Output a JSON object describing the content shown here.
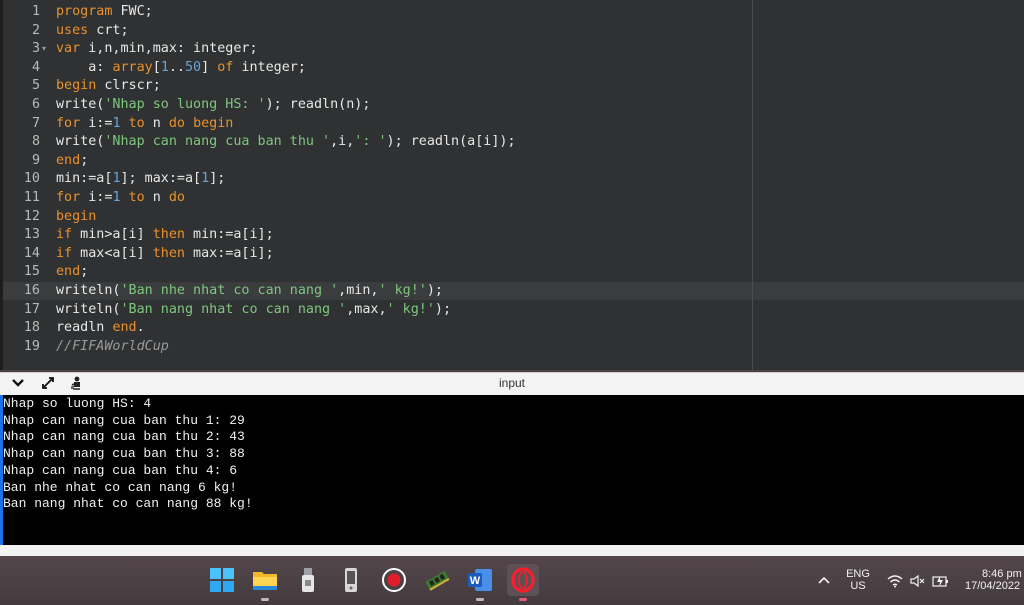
{
  "editor": {
    "lines": [
      {
        "n": "1",
        "tokens": [
          [
            "kw",
            "program"
          ],
          [
            "p",
            " FWC;"
          ]
        ]
      },
      {
        "n": "2",
        "tokens": [
          [
            "kw",
            "uses"
          ],
          [
            "p",
            " crt;"
          ]
        ]
      },
      {
        "n": "3",
        "fold": true,
        "tokens": [
          [
            "kw",
            "var"
          ],
          [
            "p",
            " i,n,min,max: integer;"
          ]
        ]
      },
      {
        "n": "4",
        "tokens": [
          [
            "p",
            "    a: "
          ],
          [
            "kw",
            "array"
          ],
          [
            "p",
            "["
          ],
          [
            "num",
            "1"
          ],
          [
            "p",
            ".."
          ],
          [
            "num",
            "50"
          ],
          [
            "p",
            "] "
          ],
          [
            "kw",
            "of"
          ],
          [
            "p",
            " integer;"
          ]
        ]
      },
      {
        "n": "5",
        "tokens": [
          [
            "kw",
            "begin"
          ],
          [
            "p",
            " clrscr;"
          ]
        ]
      },
      {
        "n": "6",
        "tokens": [
          [
            "p",
            "write("
          ],
          [
            "str",
            "'Nhap so luong HS: '"
          ],
          [
            "p",
            "); readln(n);"
          ]
        ]
      },
      {
        "n": "7",
        "tokens": [
          [
            "kw",
            "for"
          ],
          [
            "p",
            " i:="
          ],
          [
            "num",
            "1"
          ],
          [
            "p",
            " "
          ],
          [
            "kw",
            "to"
          ],
          [
            "p",
            " n "
          ],
          [
            "kw",
            "do"
          ],
          [
            "p",
            " "
          ],
          [
            "kw",
            "begin"
          ]
        ]
      },
      {
        "n": "8",
        "tokens": [
          [
            "p",
            "write("
          ],
          [
            "str",
            "'Nhap can nang cua ban thu '"
          ],
          [
            "p",
            ",i,"
          ],
          [
            "str",
            "': '"
          ],
          [
            "p",
            "); readln(a[i]);"
          ]
        ]
      },
      {
        "n": "9",
        "tokens": [
          [
            "kw",
            "end"
          ],
          [
            "p",
            ";"
          ]
        ]
      },
      {
        "n": "10",
        "tokens": [
          [
            "p",
            "min:=a["
          ],
          [
            "num",
            "1"
          ],
          [
            "p",
            "]; max:=a["
          ],
          [
            "num",
            "1"
          ],
          [
            "p",
            "];"
          ]
        ]
      },
      {
        "n": "11",
        "tokens": [
          [
            "kw",
            "for"
          ],
          [
            "p",
            " i:="
          ],
          [
            "num",
            "1"
          ],
          [
            "p",
            " "
          ],
          [
            "kw",
            "to"
          ],
          [
            "p",
            " n "
          ],
          [
            "kw",
            "do"
          ]
        ]
      },
      {
        "n": "12",
        "tokens": [
          [
            "kw",
            "begin"
          ]
        ]
      },
      {
        "n": "13",
        "tokens": [
          [
            "kw",
            "if"
          ],
          [
            "p",
            " min>a[i] "
          ],
          [
            "kw",
            "then"
          ],
          [
            "p",
            " min:=a[i];"
          ]
        ]
      },
      {
        "n": "14",
        "tokens": [
          [
            "kw",
            "if"
          ],
          [
            "p",
            " max<a[i] "
          ],
          [
            "kw",
            "then"
          ],
          [
            "p",
            " max:=a[i];"
          ]
        ]
      },
      {
        "n": "15",
        "tokens": [
          [
            "kw",
            "end"
          ],
          [
            "p",
            ";"
          ]
        ]
      },
      {
        "n": "16",
        "tokens": [
          [
            "p",
            "writeln("
          ],
          [
            "str",
            "'Ban nhe nhat co can nang '"
          ],
          [
            "p",
            ",min,"
          ],
          [
            "str",
            "' kg!'"
          ],
          [
            "p",
            ");"
          ]
        ]
      },
      {
        "n": "17",
        "tokens": [
          [
            "p",
            "writeln("
          ],
          [
            "str",
            "'Ban nang nhat co can nang '"
          ],
          [
            "p",
            ",max,"
          ],
          [
            "str",
            "' kg!'"
          ],
          [
            "p",
            ");"
          ]
        ]
      },
      {
        "n": "18",
        "tokens": [
          [
            "p",
            "readln "
          ],
          [
            "kw",
            "end"
          ],
          [
            "p",
            "."
          ]
        ]
      },
      {
        "n": "19",
        "tokens": [
          [
            "cm",
            "//FIFAWorldCup"
          ]
        ]
      }
    ],
    "highlighted_line": "16"
  },
  "panel": {
    "title": "input",
    "icons": [
      "chevron-down-icon",
      "expand-icon",
      "run-person-icon"
    ]
  },
  "console": {
    "lines": [
      "Nhap so luong HS: 4",
      "Nhap can nang cua ban thu 1: 29",
      "Nhap can nang cua ban thu 2: 43",
      "Nhap can nang cua ban thu 3: 88",
      "Nhap can nang cua ban thu 4: 6",
      "Ban nhe nhat co can nang 6 kg!",
      "Ban nang nhat co can nang 88 kg!"
    ]
  },
  "taskbar": {
    "apps": [
      {
        "name": "start-icon",
        "running": false
      },
      {
        "name": "file-explorer-icon",
        "running": true
      },
      {
        "name": "usb-drive-icon",
        "running": false
      },
      {
        "name": "phone-device-icon",
        "running": false
      },
      {
        "name": "record-icon",
        "running": false
      },
      {
        "name": "memory-chip-icon",
        "running": false
      },
      {
        "name": "word-icon",
        "running": true
      },
      {
        "name": "opera-icon",
        "running": true
      }
    ],
    "tray": {
      "lang_top": "ENG",
      "lang_bottom": "US",
      "time": "8:46 pm",
      "date": "17/04/2022"
    }
  },
  "colors": {
    "editor_bg": "#2f3132",
    "keyword": "#e8912d",
    "string": "#7ec77e",
    "number": "#6aa3d8",
    "console_bg": "#000000",
    "console_border": "#1a73e8"
  }
}
